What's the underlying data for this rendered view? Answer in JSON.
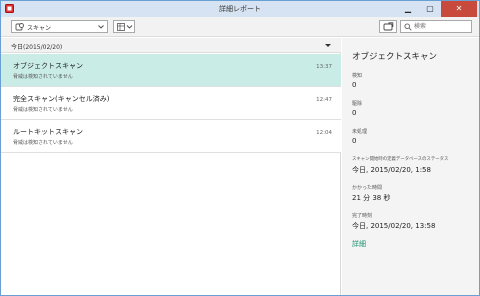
{
  "window": {
    "title": "詳細レポート"
  },
  "toolbar": {
    "scan_select": "スキャン",
    "search_placeholder": "検索"
  },
  "list": {
    "group_label": "今日(2015/02/20)",
    "items": [
      {
        "name": "オブジェクトスキャン",
        "status": "脅威は検知されていません",
        "time": "13:37",
        "selected": true
      },
      {
        "name": "完全スキャン(キャンセル済み)",
        "status": "脅威は検知されていません",
        "time": "12:47",
        "selected": false
      },
      {
        "name": "ルートキットスキャン",
        "status": "脅威は検知されていません",
        "time": "12:04",
        "selected": false
      }
    ]
  },
  "detail": {
    "title": "オブジェクトスキャン",
    "fields": [
      {
        "label": "検知",
        "value": "0"
      },
      {
        "label": "駆除",
        "value": "0"
      },
      {
        "label": "未処理",
        "value": "0"
      },
      {
        "label": "スキャン開始時の定義データベースのステータス",
        "value": "今日, 2015/02/20, 1:58"
      },
      {
        "label": "かかった時間",
        "value": "21 分 38 秒"
      },
      {
        "label": "完了時刻",
        "value": "今日, 2015/02/20, 13:58"
      }
    ],
    "details_link": "詳細"
  },
  "colors": {
    "accent": "#1a8f6e",
    "selected_row": "#c9ece6",
    "close_button": "#c74a3c"
  }
}
